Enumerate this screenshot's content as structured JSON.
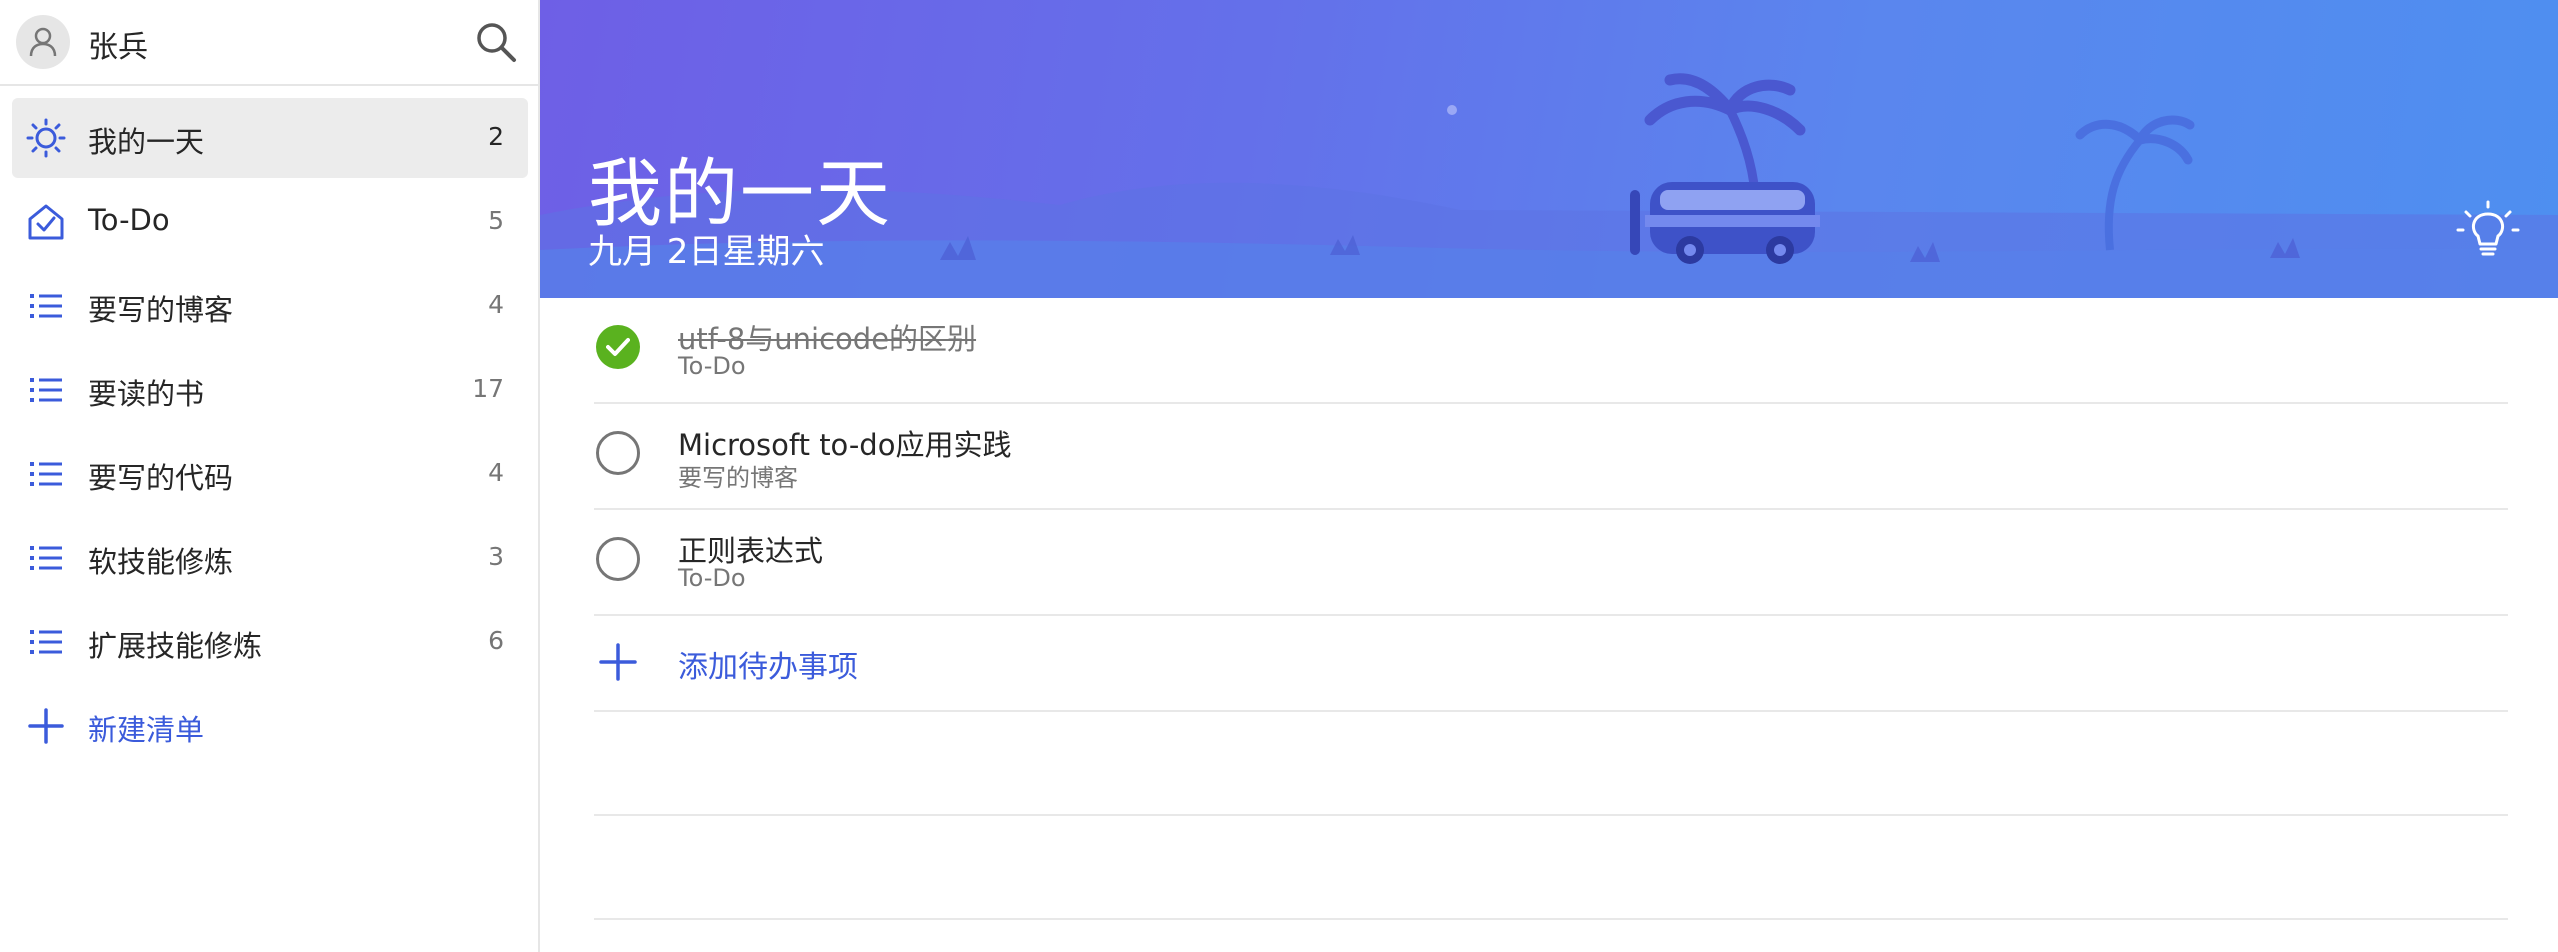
{
  "user": {
    "name": "张兵"
  },
  "sidebar": {
    "items": [
      {
        "label": "我的一天",
        "count": "2",
        "icon": "sun-icon",
        "active": true
      },
      {
        "label": "To-Do",
        "count": "5",
        "icon": "home-check-icon"
      },
      {
        "label": "要写的博客",
        "count": "4",
        "icon": "list-icon"
      },
      {
        "label": "要读的书",
        "count": "17",
        "icon": "list-icon"
      },
      {
        "label": "要写的代码",
        "count": "4",
        "icon": "list-icon"
      },
      {
        "label": "软技能修炼",
        "count": "3",
        "icon": "list-icon"
      },
      {
        "label": "扩展技能修炼",
        "count": "6",
        "icon": "list-icon"
      }
    ],
    "new_list_label": "新建清单"
  },
  "banner": {
    "title": "我的一天",
    "date": "九月 2日星期六"
  },
  "tasks": [
    {
      "title": "utf-8与unicode的区别",
      "list": "To-Do",
      "completed": true
    },
    {
      "title": "Microsoft to-do应用实践",
      "list": "要写的博客",
      "completed": false
    },
    {
      "title": "正则表达式",
      "list": "To-Do",
      "completed": false
    }
  ],
  "add_task_label": "添加待办事项",
  "colors": {
    "accent": "#3b5bdb",
    "done_green": "#5ab21f",
    "banner_start": "#6e5fe6",
    "banner_end": "#4e8ff0"
  }
}
